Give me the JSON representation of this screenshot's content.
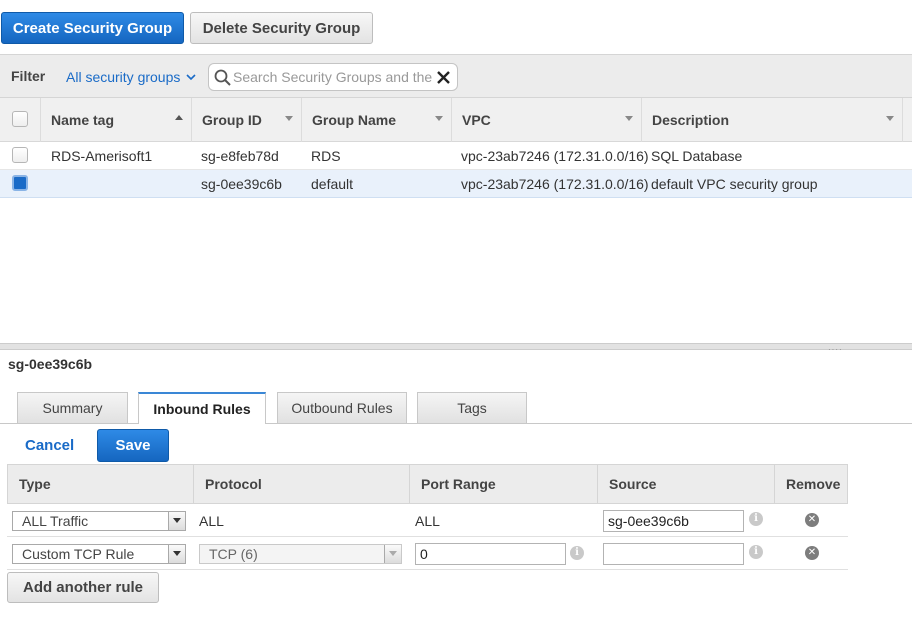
{
  "toolbar": {
    "create_label": "Create Security Group",
    "delete_label": "Delete Security Group"
  },
  "filter": {
    "label": "Filter",
    "dropdown_value": "All security groups",
    "search_placeholder": "Search Security Groups and their properties"
  },
  "grid": {
    "columns": [
      {
        "label": "Name tag",
        "sort": "asc"
      },
      {
        "label": "Group ID"
      },
      {
        "label": "Group Name"
      },
      {
        "label": "VPC"
      },
      {
        "label": "Description"
      }
    ],
    "rows": [
      {
        "name_tag": "RDS-Amerisoft1",
        "group_id": "sg-e8feb78d",
        "group_name": "RDS",
        "vpc": "vpc-23ab7246 (172.31.0.0/16)",
        "description": "SQL Database",
        "checked": false
      },
      {
        "name_tag": "",
        "group_id": "sg-0ee39c6b",
        "group_name": "default",
        "vpc": "vpc-23ab7246 (172.31.0.0/16)",
        "description": "default VPC security group",
        "checked": true
      }
    ]
  },
  "detail": {
    "title": "sg-0ee39c6b",
    "tabs": [
      {
        "label": "Summary"
      },
      {
        "label": "Inbound Rules",
        "active": true
      },
      {
        "label": "Outbound Rules"
      },
      {
        "label": "Tags"
      }
    ],
    "cancel_label": "Cancel",
    "save_label": "Save",
    "rules_columns": [
      "Type",
      "Protocol",
      "Port Range",
      "Source",
      "Remove"
    ],
    "rules": [
      {
        "type": "ALL Traffic",
        "protocol": "ALL",
        "port_range": "ALL",
        "source": "sg-0ee39c6b"
      },
      {
        "type": "Custom TCP Rule",
        "protocol": "TCP (6)",
        "port_range": "0",
        "source": ""
      }
    ],
    "add_rule_label": "Add another rule"
  },
  "icons": {
    "search": "search-icon",
    "clear": "close-icon",
    "info": "info-icon",
    "remove": "remove-icon"
  },
  "colors": {
    "primary": "#1a6bc7",
    "selected_row": "#e9f1fb"
  }
}
